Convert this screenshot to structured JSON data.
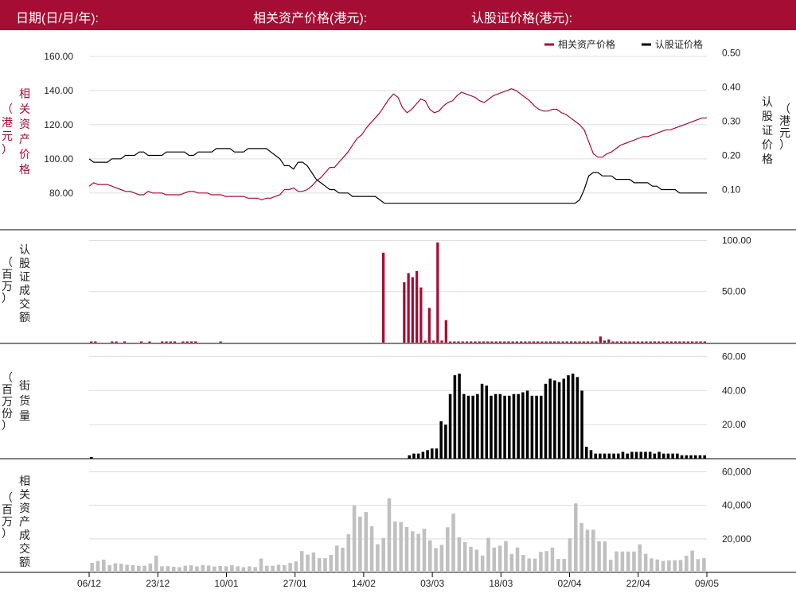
{
  "header": {
    "date_label": "日期(日/月/年):",
    "asset_price_label": "相关资产价格(港元):",
    "warrant_price_label": "认股证价格(港元):"
  },
  "colors": {
    "brand": "#a50d34",
    "asset_line": "#a50d34",
    "warrant_line": "#000000",
    "warrant_turnover_bar": "#a50d34",
    "outstanding_bar": "#000000",
    "asset_turnover_bar": "#c0c0c0",
    "grid": "#dddddd"
  },
  "chart_data": [
    {
      "type": "line",
      "panel": "price",
      "legend": [
        "相关资产价格",
        "认股证价格"
      ],
      "left_axis_label": "相关资产价格（港元）",
      "right_axis_label": "认股证价格（港元）",
      "left_ticks": [
        "160.00",
        "140.00",
        "120.00",
        "100.00",
        "80.00"
      ],
      "left_tick_values": [
        160,
        140,
        120,
        100,
        80
      ],
      "right_ticks": [
        "0.50",
        "0.40",
        "0.30",
        "0.20",
        "0.10"
      ],
      "right_tick_values": [
        0.5,
        0.4,
        0.3,
        0.2,
        0.1
      ],
      "ylim_left": [
        72,
        166
      ],
      "ylim_right": [
        0.05,
        0.52
      ],
      "grid": true,
      "legend_position": "top-right",
      "series": [
        {
          "name": "相关资产价格",
          "axis": "left",
          "values": [
            84,
            86,
            85,
            85,
            85,
            84,
            83,
            82,
            81,
            81,
            80,
            79,
            79,
            81,
            80,
            80,
            80,
            79,
            79,
            79,
            79,
            80,
            81,
            81,
            80,
            80,
            80,
            79,
            79,
            79,
            78,
            78,
            78,
            78,
            78,
            77,
            77,
            77,
            76,
            77,
            77,
            78,
            79,
            82,
            82,
            83,
            81,
            81,
            82,
            84,
            87,
            89,
            92,
            95,
            95,
            98,
            101,
            104,
            108,
            112,
            114,
            118,
            121,
            124,
            127,
            131,
            135,
            138,
            136,
            130,
            127,
            129,
            132,
            135,
            134,
            129,
            127,
            128,
            131,
            133,
            134,
            137,
            139,
            138,
            137,
            136,
            134,
            133,
            135,
            137,
            138,
            139,
            140,
            141,
            140,
            138,
            136,
            134,
            131,
            129,
            128,
            128,
            129,
            129,
            127,
            126,
            124,
            122,
            120,
            117,
            110,
            103,
            101,
            101,
            103,
            104,
            106,
            108,
            109,
            110,
            111,
            112,
            113,
            113,
            114,
            115,
            116,
            117,
            117,
            118,
            119,
            120,
            121,
            122,
            123,
            124,
            124
          ]
        },
        {
          "name": "认股证价格",
          "axis": "right",
          "values": [
            0.19,
            0.18,
            0.18,
            0.18,
            0.18,
            0.19,
            0.19,
            0.19,
            0.2,
            0.2,
            0.2,
            0.21,
            0.21,
            0.2,
            0.2,
            0.2,
            0.2,
            0.21,
            0.21,
            0.21,
            0.21,
            0.21,
            0.2,
            0.2,
            0.21,
            0.21,
            0.21,
            0.21,
            0.22,
            0.22,
            0.22,
            0.22,
            0.21,
            0.21,
            0.21,
            0.22,
            0.22,
            0.22,
            0.22,
            0.22,
            0.21,
            0.2,
            0.19,
            0.17,
            0.17,
            0.16,
            0.18,
            0.18,
            0.17,
            0.15,
            0.13,
            0.12,
            0.11,
            0.1,
            0.1,
            0.09,
            0.09,
            0.09,
            0.08,
            0.08,
            0.08,
            0.08,
            0.08,
            0.08,
            0.07,
            0.06,
            0.06,
            0.06,
            0.06,
            0.06,
            0.06,
            0.06,
            0.06,
            0.06,
            0.06,
            0.06,
            0.06,
            0.06,
            0.06,
            0.06,
            0.06,
            0.06,
            0.06,
            0.06,
            0.06,
            0.06,
            0.06,
            0.06,
            0.06,
            0.06,
            0.06,
            0.06,
            0.06,
            0.06,
            0.06,
            0.06,
            0.06,
            0.06,
            0.06,
            0.06,
            0.06,
            0.06,
            0.06,
            0.06,
            0.06,
            0.06,
            0.06,
            0.06,
            0.07,
            0.1,
            0.14,
            0.15,
            0.15,
            0.14,
            0.14,
            0.14,
            0.13,
            0.13,
            0.13,
            0.13,
            0.12,
            0.12,
            0.12,
            0.12,
            0.11,
            0.11,
            0.1,
            0.1,
            0.1,
            0.1,
            0.09,
            0.09,
            0.09,
            0.09,
            0.09,
            0.09,
            0.09
          ]
        }
      ]
    },
    {
      "type": "bar",
      "panel": "warrant_turnover",
      "axis_label": "认股证成交额（百万）",
      "ticks": [
        "100.00",
        "50.00"
      ],
      "tick_values": [
        100,
        50
      ],
      "ylim": [
        0,
        105
      ],
      "values": [
        1,
        1,
        0,
        0,
        0,
        1,
        1,
        0,
        1,
        0,
        0,
        0,
        1,
        0,
        1,
        0,
        0,
        1,
        1,
        1,
        1,
        0,
        1,
        1,
        1,
        1,
        0,
        0,
        0,
        0,
        0,
        1,
        0,
        0,
        0,
        0,
        0,
        0,
        0,
        0,
        0,
        0,
        0,
        0,
        0,
        0,
        0,
        0,
        0,
        0,
        0,
        0,
        0,
        0,
        0,
        0,
        0,
        0,
        0,
        0,
        0,
        0,
        0,
        0,
        0,
        0,
        0,
        0,
        0,
        0,
        88,
        0,
        0,
        0,
        0,
        59,
        68,
        64,
        70,
        54,
        2,
        34,
        2,
        98,
        2,
        22,
        1,
        1,
        1,
        1,
        1,
        1,
        1,
        1,
        1,
        1,
        1,
        1,
        1,
        1,
        1,
        1,
        1,
        1,
        1,
        1,
        1,
        1,
        1,
        1,
        1,
        1,
        1,
        1,
        1,
        1,
        1,
        1,
        1,
        1,
        1,
        1,
        6,
        2,
        3,
        1,
        1,
        1,
        1,
        1,
        1,
        1,
        1,
        1,
        1,
        1,
        1,
        1,
        1,
        1,
        1,
        1,
        1,
        1,
        1,
        1,
        1,
        1
      ]
    },
    {
      "type": "bar",
      "panel": "outstanding",
      "axis_label": "街货量（百万份）",
      "ticks": [
        "60.00",
        "40.00",
        "20.00"
      ],
      "tick_values": [
        60,
        40,
        20
      ],
      "ylim": [
        0,
        64
      ],
      "values": [
        1,
        0,
        0,
        0,
        0,
        0,
        0,
        0,
        0,
        0,
        0,
        0,
        0,
        0,
        0,
        0,
        0,
        0,
        0,
        0,
        0,
        0,
        0,
        0,
        0,
        0,
        0,
        0,
        0,
        0,
        0,
        0,
        0,
        0,
        0,
        0,
        0,
        0,
        0,
        0,
        0,
        0,
        0,
        0,
        0,
        0,
        0,
        0,
        0,
        0,
        0,
        0,
        0,
        0,
        0,
        0,
        0,
        0,
        0,
        0,
        0,
        0,
        0,
        0,
        0,
        0,
        0,
        0,
        0,
        0,
        2,
        3,
        3,
        4,
        5,
        6,
        6,
        22,
        20,
        38,
        49,
        50,
        38,
        37,
        37,
        38,
        44,
        43,
        37,
        38,
        38,
        37,
        37,
        38,
        38,
        39,
        40,
        37,
        37,
        37,
        44,
        47,
        46,
        45,
        47,
        49,
        50,
        48,
        40,
        7,
        5,
        3,
        3,
        3,
        3,
        3,
        3,
        4,
        3,
        4,
        4,
        4,
        4,
        4,
        3,
        4,
        3,
        3,
        3,
        3,
        2,
        2,
        2,
        2,
        2,
        2
      ]
    },
    {
      "type": "bar",
      "panel": "asset_turnover",
      "axis_label": "相关资产成交额（百万）",
      "ticks": [
        "60,000",
        "40,000",
        "20,000"
      ],
      "tick_values": [
        60000,
        40000,
        20000
      ],
      "ylim": [
        0,
        64000
      ],
      "values": [
        5700,
        6800,
        7600,
        4300,
        5400,
        5200,
        4500,
        4300,
        3800,
        4000,
        5300,
        10000,
        3600,
        3700,
        3300,
        3100,
        4000,
        4200,
        3600,
        4400,
        4100,
        3500,
        3800,
        3600,
        4300,
        3600,
        3100,
        3600,
        3200,
        8300,
        3900,
        3900,
        4500,
        4300,
        5600,
        6500,
        12700,
        10600,
        11800,
        8500,
        8500,
        10500,
        16000,
        14700,
        22700,
        39800,
        33300,
        36000,
        27500,
        16800,
        20500,
        44200,
        30300,
        30000,
        27000,
        24500,
        23000,
        26000,
        19100,
        14500,
        16400,
        26900,
        35000,
        20900,
        18100,
        15200,
        13600,
        10000,
        20600,
        14800,
        15900,
        18700,
        11000,
        14800,
        10400,
        8300,
        8200,
        12200,
        12700,
        14800,
        8000,
        8000,
        20300,
        41100,
        29500,
        25400,
        25400,
        18500,
        18500,
        7500,
        12500,
        12400,
        12400,
        12400,
        16700,
        11100,
        8400,
        7700,
        6800,
        7100,
        7200,
        7400,
        9900,
        13000,
        7900,
        8500
      ]
    }
  ],
  "x_axis": {
    "ticks": [
      "06/12",
      "23/12",
      "10/01",
      "27/01",
      "14/02",
      "03/03",
      "18/03",
      "02/04",
      "22/04",
      "09/05"
    ]
  }
}
